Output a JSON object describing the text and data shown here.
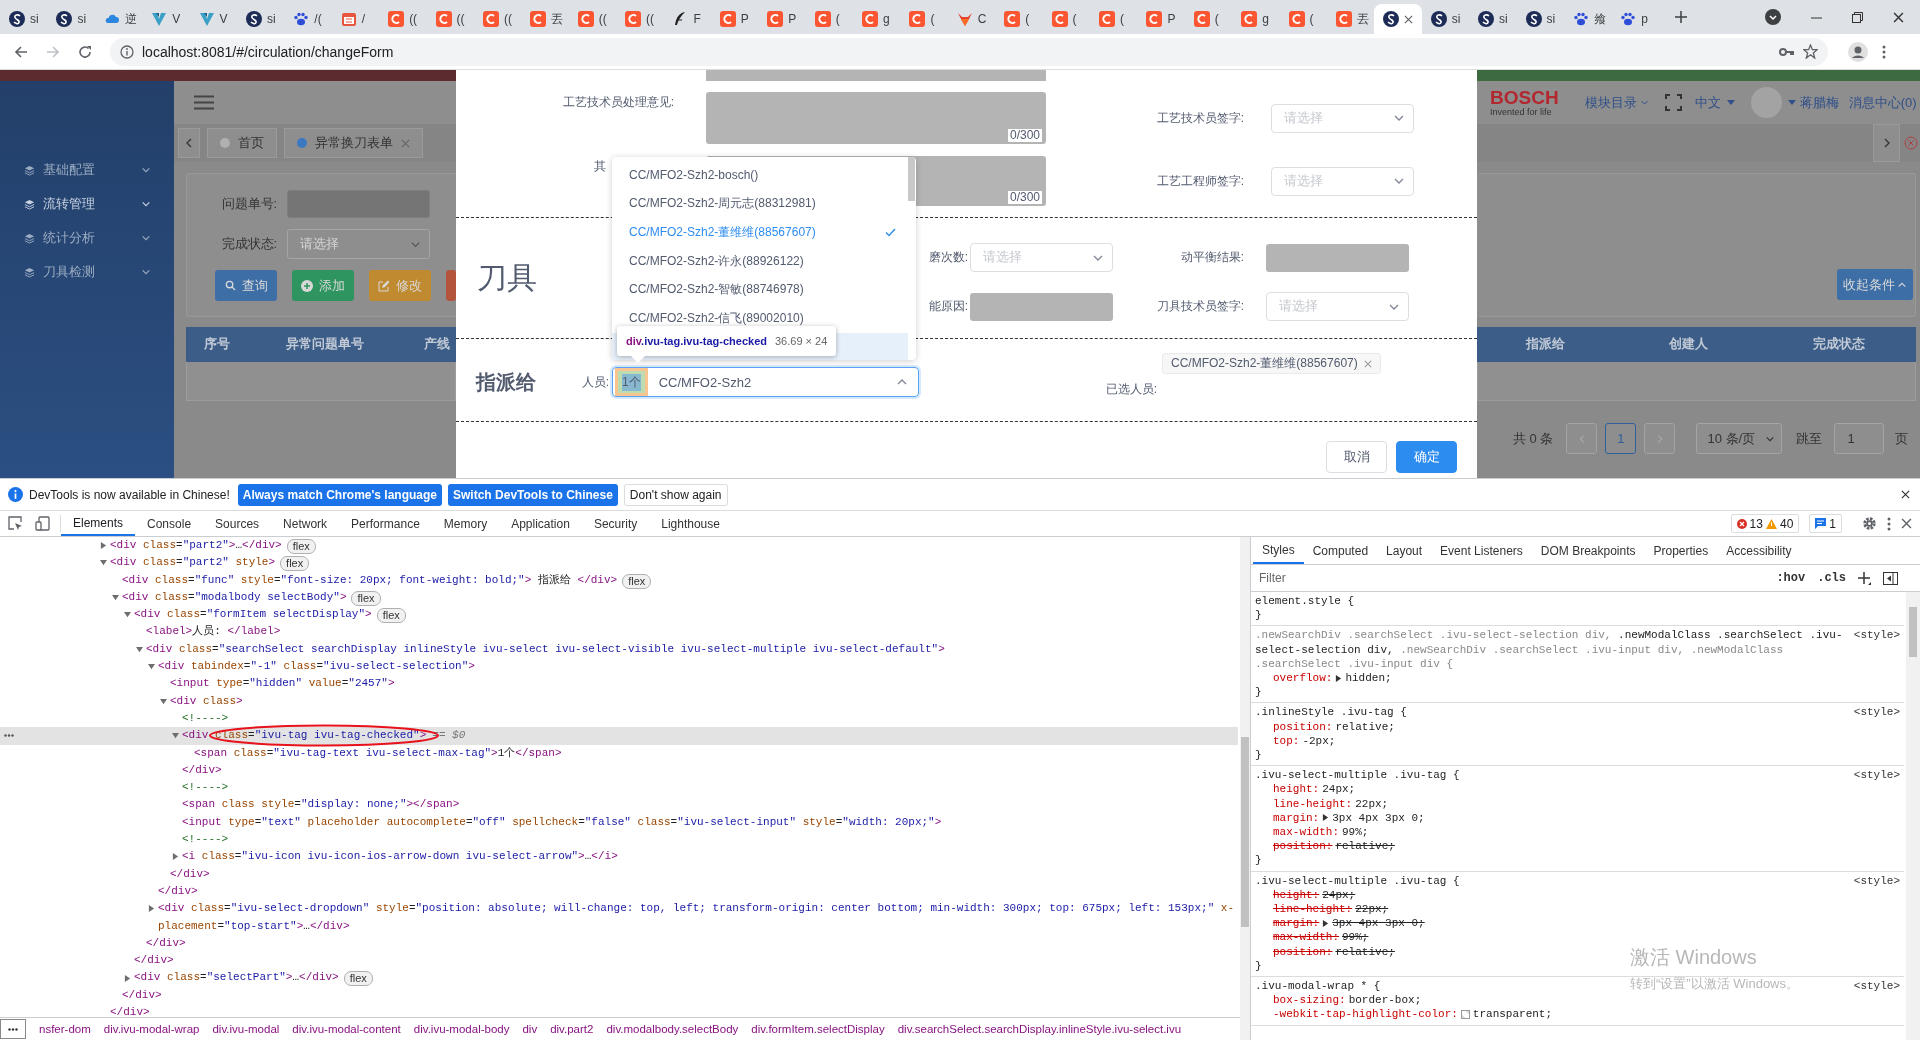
{
  "browser": {
    "tabs": [
      {
        "kind": "s",
        "title": "si",
        "selected": false
      },
      {
        "kind": "s",
        "title": "si",
        "selected": false
      },
      {
        "kind": "cloud",
        "title": "逆",
        "selected": false
      },
      {
        "kind": "v",
        "title": "V",
        "selected": false
      },
      {
        "kind": "v",
        "title": "V",
        "selected": false
      },
      {
        "kind": "s",
        "title": "si",
        "selected": false
      },
      {
        "kind": "paw",
        "title": "/(",
        "selected": false
      },
      {
        "kind": "cal",
        "title": "/",
        "selected": false
      },
      {
        "kind": "red",
        "title": "((",
        "selected": false
      },
      {
        "kind": "red",
        "title": "((",
        "selected": false
      },
      {
        "kind": "red",
        "title": "((",
        "selected": false
      },
      {
        "kind": "red",
        "title": "丟",
        "selected": false
      },
      {
        "kind": "red",
        "title": "((",
        "selected": false
      },
      {
        "kind": "red",
        "title": "((",
        "selected": false
      },
      {
        "kind": "pen",
        "title": "F",
        "selected": false
      },
      {
        "kind": "red",
        "title": "P",
        "selected": false
      },
      {
        "kind": "red",
        "title": "P",
        "selected": false
      },
      {
        "kind": "red",
        "title": "(",
        "selected": false
      },
      {
        "kind": "red",
        "title": "g",
        "selected": false
      },
      {
        "kind": "red",
        "title": "(",
        "selected": false
      },
      {
        "kind": "fox",
        "title": "C",
        "selected": false
      },
      {
        "kind": "red",
        "title": "(",
        "selected": false
      },
      {
        "kind": "red",
        "title": "(",
        "selected": false
      },
      {
        "kind": "red",
        "title": "(",
        "selected": false
      },
      {
        "kind": "red",
        "title": "P",
        "selected": false
      },
      {
        "kind": "red",
        "title": "(",
        "selected": false
      },
      {
        "kind": "red",
        "title": "g",
        "selected": false
      },
      {
        "kind": "red",
        "title": "(",
        "selected": false
      },
      {
        "kind": "red",
        "title": "丟",
        "selected": false
      },
      {
        "kind": "s",
        "selected": true
      },
      {
        "kind": "s",
        "title": "si",
        "selected": false
      },
      {
        "kind": "s",
        "title": "si",
        "selected": false
      },
      {
        "kind": "s",
        "title": "si",
        "selected": false
      },
      {
        "kind": "paw",
        "title": "飨",
        "selected": false
      },
      {
        "kind": "paw",
        "title": "p",
        "selected": false
      }
    ],
    "url": "localhost:8081/#/circulation/changeForm"
  },
  "app": {
    "sidebar": [
      {
        "label": "基础配置",
        "selected": false
      },
      {
        "label": "流转管理",
        "selected": true
      },
      {
        "label": "统计分析",
        "selected": false
      },
      {
        "label": "刀具检测",
        "selected": false
      }
    ],
    "tabs": [
      {
        "label": "首页",
        "selected": false
      },
      {
        "label": "异常换刀表单",
        "selected": true
      }
    ],
    "filters": [
      {
        "label": "问题单号:",
        "kind": "input"
      },
      {
        "label": "完成状态:",
        "kind": "select",
        "placeholder": "请选择"
      }
    ],
    "buttons": [
      {
        "label": "查询",
        "kind": "search",
        "color": "#3d6ea6"
      },
      {
        "label": "添加",
        "kind": "add",
        "color": "#2f9560"
      },
      {
        "label": "修改",
        "kind": "edit",
        "color": "#c08a30"
      },
      {
        "kind": "delete",
        "color": "#b4543c"
      }
    ],
    "columns": [
      "序号",
      "异常问题单号",
      "产线",
      "指派给",
      "创建人",
      "完成状态"
    ],
    "header": {
      "logo": "BOSCH",
      "tagline": "Invented for life",
      "menu": "模块目录",
      "language": "中文",
      "user": "蒋腊梅",
      "messages": "消息中心(0)"
    },
    "collapse_button": "收起条件",
    "pagination": {
      "total": "共 0 条",
      "pages": [
        {
          "label": "1",
          "selected": true
        }
      ],
      "page_size": "10 条/页",
      "jump_label": "跳至",
      "jump_value": "1",
      "page_suffix": "页"
    }
  },
  "modal": {
    "process_rows": [
      {
        "label": "工艺技术员处理意见:",
        "counter": "0/300",
        "sign_label": "工艺技术员签字:",
        "sign_placeholder": "请选择"
      },
      {
        "label": "其",
        "counter": "0/300",
        "sign_label": "工艺工程师签字:",
        "sign_placeholder": "请选择"
      }
    ],
    "tool_section": {
      "title": "刀具",
      "rows": [
        {
          "label": "磨次数:",
          "field": {
            "kind": "select",
            "placeholder": "请选择"
          },
          "right_label": "动平衡结果:",
          "right_field": {
            "kind": "input"
          }
        },
        {
          "label": "能原因:",
          "field": {
            "kind": "input"
          },
          "right_label": "刀具技术员签字:",
          "right_field": {
            "kind": "select",
            "placeholder": "请选择"
          }
        }
      ]
    },
    "assign_section": {
      "title": "指派给",
      "person_label": "人员:",
      "tag": {
        "text": "1个",
        "highlighted": true
      },
      "value": "CC/MFO2-Szh2",
      "expanded": true,
      "selected_label": "已选人员:",
      "selected_people": [
        "CC/MFO2-Szh2-董维维(88567607)"
      ]
    },
    "dropdown": [
      {
        "label": "CC/MFO2-Szh2-bosch()",
        "selected": false
      },
      {
        "label": "CC/MFO2-Szh2-周元志(88312981)",
        "selected": false
      },
      {
        "label": "CC/MFO2-Szh2-董维维(88567607)",
        "selected": true
      },
      {
        "label": "CC/MFO2-Szh2-许永(88926122)",
        "selected": false
      },
      {
        "label": "CC/MFO2-Szh2-智敏(88746978)",
        "selected": false
      },
      {
        "label": "CC/MFO2-Szh2-信飞(89002010)",
        "selected": false
      }
    ],
    "hovered_blank_row": true,
    "tooltip": {
      "tag": "div",
      "classes": ".ivu-tag.ivu-tag-checked",
      "size": "36.69 × 24"
    },
    "buttons": [
      {
        "label": "取消",
        "kind": "default"
      },
      {
        "label": "确定",
        "kind": "primary"
      }
    ]
  },
  "devtools": {
    "infobar": {
      "message": "DevTools is now available in Chinese!",
      "buttons": [
        {
          "label": "Always match Chrome's language",
          "kind": "primary"
        },
        {
          "label": "Switch DevTools to Chinese",
          "kind": "primary"
        },
        {
          "label": "Don't show again",
          "kind": "default"
        }
      ]
    },
    "tabs": [
      {
        "label": "Elements",
        "selected": true
      },
      {
        "label": "Console",
        "selected": false
      },
      {
        "label": "Sources",
        "selected": false
      },
      {
        "label": "Network",
        "selected": false
      },
      {
        "label": "Performance",
        "selected": false
      },
      {
        "label": "Memory",
        "selected": false
      },
      {
        "label": "Application",
        "selected": false
      },
      {
        "label": "Security",
        "selected": false
      },
      {
        "label": "Lighthouse",
        "selected": false
      }
    ],
    "errors": "13",
    "warnings": "40",
    "messages": "1",
    "dom": [
      {
        "text": "<div class=\"part2\">…</div>",
        "badge": "flex",
        "expanded": false,
        "selected": false
      },
      {
        "text": "<div class=\"part2\" style>",
        "badge": "flex",
        "expanded": true,
        "selected": false,
        "close": "</div>",
        "children": [
          {
            "text": "<div class=\"func\" style=\"font-size: 20px; font-weight: bold;\"> 指派给 </div>",
            "badge": "flex",
            "selected": false
          },
          {
            "text": "<div class=\"modalbody selectBody\">",
            "badge": "flex",
            "expanded": true,
            "selected": false,
            "close": "</div>",
            "children": [
              {
                "text": "<div class=\"formItem selectDisplay\">",
                "badge": "flex",
                "expanded": true,
                "selected": false,
                "close": "</div>",
                "children": [
                  {
                    "text": "<label>人员: </label>",
                    "selected": false
                  },
                  {
                    "text": "<div class=\"searchSelect searchDisplay inlineStyle ivu-select ivu-select-visible ivu-select-multiple ivu-select-default\">",
                    "expanded": true,
                    "selected": false,
                    "close": "</div>",
                    "children": [
                      {
                        "text": "<div tabindex=\"-1\" class=\"ivu-select-selection\">",
                        "expanded": true,
                        "selected": false,
                        "close": "</div>",
                        "children": [
                          {
                            "text": "<input type=\"hidden\" value=\"2457\">",
                            "selected": false
                          },
                          {
                            "text": "<div class>",
                            "expanded": true,
                            "selected": false,
                            "close": "</div>",
                            "children": [
                              {
                                "text": "<!---->",
                                "selected": false
                              },
                              {
                                "text": "<div class=\"ivu-tag ivu-tag-checked\">",
                                "expanded": true,
                                "selected": true,
                                "circled": true,
                                "suffix": "== $0",
                                "close": "</div>",
                                "children": [
                                  {
                                    "text": "<span class=\"ivu-tag-text ivu-select-max-tag\">1个</span>",
                                    "selected": false
                                  }
                                ]
                              },
                              {
                                "text": "<!---->",
                                "selected": false
                              },
                              {
                                "text": "<span class style=\"display: none;\"></span>",
                                "selected": false
                              },
                              {
                                "text": "<input type=\"text\" placeholder autocomplete=\"off\" spellcheck=\"false\" class=\"ivu-select-input\" style=\"width: 20px;\">",
                                "selected": false
                              },
                              {
                                "text": "<!---->",
                                "selected": false
                              },
                              {
                                "text": "<i class=\"ivu-icon ivu-icon-ios-arrow-down ivu-select-arrow\">…</i>",
                                "expanded": false,
                                "selected": false
                              }
                            ]
                          }
                        ]
                      },
                      {
                        "text": "<div class=\"ivu-select-dropdown\" style=\"position: absolute; will-change: top, left; transform-origin: center bottom; min-width: 300px; top: 675px; left: 153px;\" x-placement=\"top-start\">…</div>",
                        "expanded": false,
                        "selected": false
                      }
                    ]
                  }
                ]
              },
              {
                "text": "<div class=\"selectPart\">…</div>",
                "badge": "flex",
                "expanded": false,
                "selected": false
              }
            ]
          }
        ]
      }
    ],
    "breadcrumbs": [
      "nsfer-dom",
      "div.ivu-modal-wrap",
      "div.ivu-modal",
      "div.ivu-modal-content",
      "div.ivu-modal-body",
      "div",
      "div.part2",
      "div.modalbody.selectBody",
      "div.formItem.selectDisplay",
      "div.searchSelect.searchDisplay.inlineStyle.ivu-select.ivu"
    ],
    "side_tabs": [
      {
        "label": "Styles",
        "selected": true
      },
      {
        "label": "Computed",
        "selected": false
      },
      {
        "label": "Layout",
        "selected": false
      },
      {
        "label": "Event Listeners",
        "selected": false
      },
      {
        "label": "DOM Breakpoints",
        "selected": false
      },
      {
        "label": "Properties",
        "selected": false
      },
      {
        "label": "Accessibility",
        "selected": false
      }
    ],
    "filter": {
      "placeholder": "Filter",
      "hov": ":hov",
      "cls": ".cls"
    },
    "rules": [
      {
        "selectors": [
          {
            "text": "element.style {",
            "matched": true
          }
        ],
        "close": "}"
      },
      {
        "selectors": [
          {
            "text": ".newSearchDiv .searchSelect .ivu-select-selection div,",
            "matched": false
          },
          {
            "text": ".newModalClass .searchSelect .ivu-select-selection div,",
            "matched": true
          },
          {
            "text": ".newSearchDiv .searchSelect .ivu-input div,",
            "matched": false
          },
          {
            "text": ".newModalClass .searchSelect .ivu-input div {",
            "matched": false
          }
        ],
        "source": "<style>",
        "close": "}",
        "declarations": [
          {
            "name": "overflow:",
            "value": "hidden;",
            "expandable": true,
            "struck": false
          }
        ]
      },
      {
        "selectors": [
          {
            "text": ".inlineStyle .ivu-tag {",
            "matched": true
          }
        ],
        "source": "<style>",
        "close": "}",
        "declarations": [
          {
            "name": "position:",
            "value": "relative;",
            "struck": false
          },
          {
            "name": "top:",
            "value": "-2px;",
            "struck": false
          }
        ]
      },
      {
        "selectors": [
          {
            "text": ".ivu-select-multiple .ivu-tag {",
            "matched": true
          }
        ],
        "source": "<style>",
        "close": "}",
        "declarations": [
          {
            "name": "height:",
            "value": "24px;",
            "struck": false
          },
          {
            "name": "line-height:",
            "value": "22px;",
            "struck": false
          },
          {
            "name": "margin:",
            "value": "3px 4px 3px 0;",
            "expandable": true,
            "struck": false
          },
          {
            "name": "max-width:",
            "value": "99%;",
            "struck": false
          },
          {
            "name": "position:",
            "value": "relative;",
            "struck": true
          }
        ]
      },
      {
        "selectors": [
          {
            "text": ".ivu-select-multiple .ivu-tag {",
            "matched": true
          }
        ],
        "source": "<style>",
        "close": "}",
        "declarations": [
          {
            "name": "height:",
            "value": "24px;",
            "struck": true
          },
          {
            "name": "line-height:",
            "value": "22px;",
            "struck": true
          },
          {
            "name": "margin:",
            "value": "3px 4px 3px 0;",
            "expandable": true,
            "struck": true
          },
          {
            "name": "max-width:",
            "value": "99%;",
            "struck": true
          },
          {
            "name": "position:",
            "value": "relative;",
            "struck": true
          }
        ]
      },
      {
        "selectors": [
          {
            "text": ".ivu-modal-wrap * {",
            "matched": true
          }
        ],
        "source": "<style>",
        "declarations": [
          {
            "name": "box-sizing:",
            "value": "border-box;",
            "struck": false
          },
          {
            "name": "-webkit-tap-highlight-color:",
            "value": "transparent;",
            "swatch": true,
            "struck": false
          }
        ]
      }
    ]
  },
  "os_notice": {
    "title": "激活 Windows",
    "subtitle": "转到“设置”以激活 Windows。"
  }
}
